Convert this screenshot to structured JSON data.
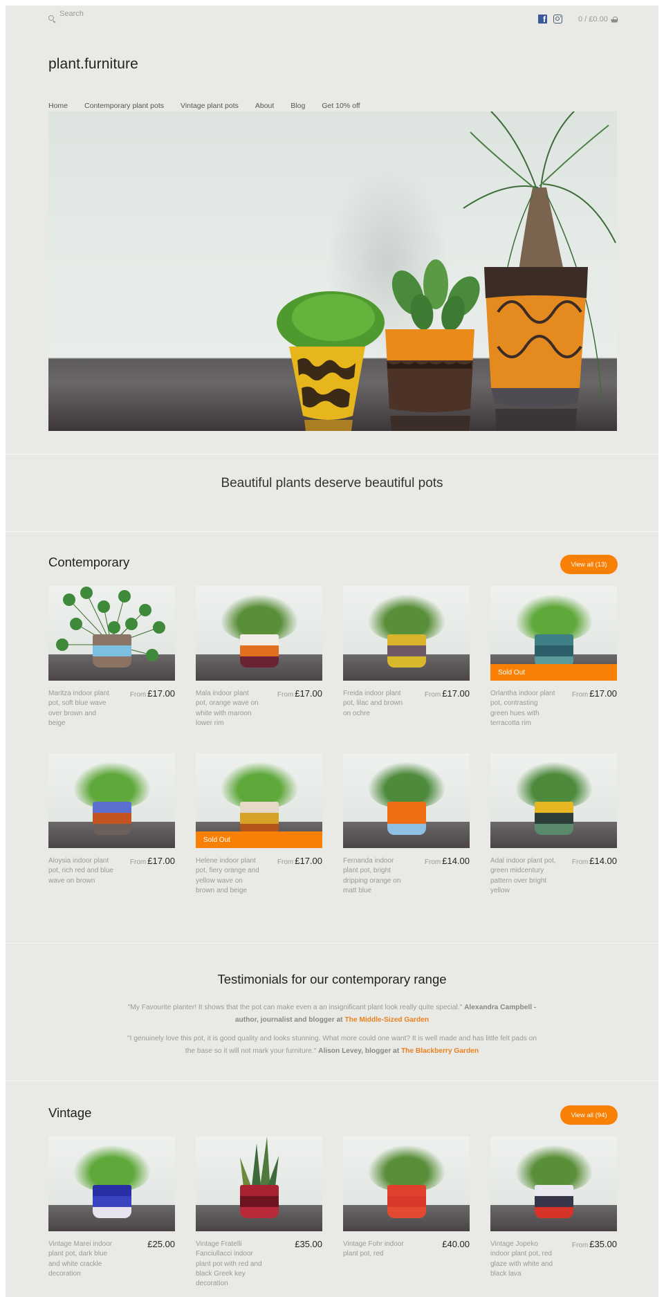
{
  "header": {
    "search_placeholder": "Search",
    "cart_label": "0 / £0.00",
    "logo": "plant.furniture",
    "social": [
      "facebook",
      "instagram"
    ]
  },
  "nav": [
    {
      "label": "Home"
    },
    {
      "label": "Contemporary plant pots"
    },
    {
      "label": "Vintage plant pots"
    },
    {
      "label": "About"
    },
    {
      "label": "Blog"
    },
    {
      "label": "Get 10% off"
    }
  ],
  "tagline": "Beautiful plants deserve beautiful pots",
  "colors": {
    "accent": "#f98006",
    "background": "#e9e9e5",
    "link": "#e8821f"
  },
  "contemporary": {
    "title": "Contemporary",
    "view_all": "View all (13)",
    "products": [
      {
        "name": "Maritza indoor plant pot, soft blue wave over brown and beige",
        "from": "From",
        "price": "£17.00",
        "sold_out": false,
        "pot": [
          "#8a7566",
          "#7cc0e0",
          "#8b7263"
        ],
        "plant": "pilea"
      },
      {
        "name": "Mala indoor plant pot, orange wave on white with maroon lower rim",
        "from": "From",
        "price": "£17.00",
        "sold_out": false,
        "pot": [
          "#f2ece6",
          "#e0701e",
          "#6b2233"
        ],
        "plant": "fern"
      },
      {
        "name": "Freida indoor plant pot, lilac and brown on ochre",
        "from": "From",
        "price": "£17.00",
        "sold_out": false,
        "pot": [
          "#d9b32a",
          "#6f5866",
          "#d8b92c"
        ],
        "plant": "fern"
      },
      {
        "name": "Orlantha indoor plant pot, contrasting green hues with terracotta rim",
        "from": "From",
        "price": "£17.00",
        "sold_out": true,
        "sold_out_label": "Sold Out",
        "pot": [
          "#3f7f86",
          "#2c5f6a",
          "#5b9a9a"
        ],
        "plant": "grass"
      },
      {
        "name": "Aloysia indoor plant pot, rich red and blue wave on brown",
        "from": "From",
        "price": "£17.00",
        "sold_out": false,
        "pot": [
          "#5b6fd1",
          "#c35420",
          "#6d5f5c"
        ],
        "plant": "grass"
      },
      {
        "name": "Helene indoor plant pot, fiery orange and yellow wave on brown and beige",
        "from": "From",
        "price": "£17.00",
        "sold_out": true,
        "sold_out_label": "Sold Out",
        "pot": [
          "#e6d9c7",
          "#d6a225",
          "#b4541b"
        ],
        "plant": "grass"
      },
      {
        "name": "Fernanda indoor plant pot, bright dripping orange on matt blue",
        "from": "From",
        "price": "£14.00",
        "sold_out": false,
        "pot": [
          "#ef6e14",
          "#ef6e14",
          "#8ec0e4"
        ],
        "plant": "jade"
      },
      {
        "name": "Adal indoor plant pot, green midcentury pattern over bright yellow",
        "from": "From",
        "price": "£14.00",
        "sold_out": false,
        "pot": [
          "#e7b623",
          "#2d3d3a",
          "#5a8a6b"
        ],
        "plant": "jade"
      }
    ]
  },
  "testimonials": {
    "title": "Testimonials for our contemporary range",
    "items": [
      {
        "quote": "\"My Favourite planter! It shows that the pot can make even a an insignificant plant look really quite special.\"",
        "author": "Alexandra Campbell - author, journalist and blogger at",
        "link": "The Middle-Sized Garden"
      },
      {
        "quote": "\"I genuinely love this pot, it is good quality and looks stunning.  What more could one want? It is well made and has little felt pads on the base so it will not mark your furniture.\"",
        "author": "Alison Levey, blogger at",
        "link": "The Blackberry Garden"
      }
    ]
  },
  "vintage": {
    "title": "Vintage",
    "view_all": "View all (94)",
    "products": [
      {
        "name": "Vintage Marei indoor plant pot, dark blue and white crackle decoration",
        "from": "",
        "price": "£25.00",
        "sold_out": false,
        "pot": [
          "#2a2fa6",
          "#3a43c0",
          "#e6e3ee"
        ],
        "plant": "grass"
      },
      {
        "name": "Vintage Fratelli Fanciullacci indoor plant pot with red and black Greek key decoration",
        "from": "",
        "price": "£35.00",
        "sold_out": false,
        "pot": [
          "#a82232",
          "#6e1320",
          "#b82a3a"
        ],
        "plant": "snake"
      },
      {
        "name": "Vintage Fohr indoor plant pot, red",
        "from": "",
        "price": "£40.00",
        "sold_out": false,
        "pot": [
          "#e0412c",
          "#d8392a",
          "#e24a32"
        ],
        "plant": "fern"
      },
      {
        "name": "Vintage Jopeko indoor plant pot, red glaze with white and black lava",
        "from": "From",
        "price": "£35.00",
        "sold_out": false,
        "pot": [
          "#e8e8ee",
          "#36354a",
          "#d63428"
        ],
        "plant": "fern"
      }
    ]
  }
}
